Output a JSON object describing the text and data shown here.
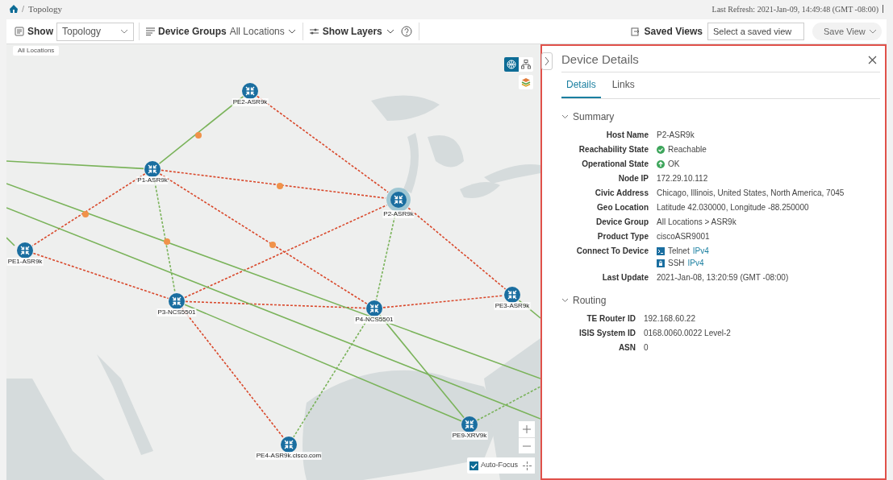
{
  "breadcrumb": {
    "separator": "/",
    "items": [
      "Topology"
    ],
    "last_refresh": "Last Refresh: 2021-Jan-09, 14:49:48 (GMT -08:00)"
  },
  "toolbar": {
    "show_label": "Show",
    "show_value": "Topology",
    "device_groups_label": "Device Groups",
    "device_groups_value": "All Locations",
    "show_layers": "Show Layers",
    "saved_views_label": "Saved Views",
    "saved_view_placeholder": "Select a saved view",
    "save_view": "Save View"
  },
  "map": {
    "badge": "All Locations",
    "nodes": [
      {
        "label": "PE2-ASR9k",
        "selected": false
      },
      {
        "label": "P1-ASR9k",
        "selected": false
      },
      {
        "label": "P2-ASR9k",
        "selected": true
      },
      {
        "label": "PE1-ASR9k",
        "selected": false
      },
      {
        "label": "P3-NCS5501",
        "selected": false
      },
      {
        "label": "P4-NCS5501",
        "selected": false
      },
      {
        "label": "PE3-ASR9k",
        "selected": false
      },
      {
        "label": "PE9-XRV9k",
        "selected": false
      },
      {
        "label": "PE4-ASR9k.cisco.com",
        "selected": false
      }
    ],
    "view_modes": [
      {
        "kind": "geo",
        "selected": true
      },
      {
        "kind": "logical",
        "selected": false
      }
    ],
    "auto_focus": {
      "label": "Auto-Focus",
      "checked": true
    }
  },
  "panel": {
    "title": "Device Details",
    "tabs": [
      {
        "label": "Details",
        "selected": true
      },
      {
        "label": "Links",
        "selected": false
      }
    ],
    "sections": [
      {
        "title": "Summary",
        "expanded": true,
        "rows": [
          {
            "label": "Host Name",
            "kind": "text",
            "value": "P2-ASR9k"
          },
          {
            "label": "Reachability State",
            "kind": "reachable",
            "value": "Reachable"
          },
          {
            "label": "Operational State",
            "kind": "up",
            "value": "OK"
          },
          {
            "label": "Node IP",
            "kind": "text",
            "value": "172.29.10.112"
          },
          {
            "label": "Civic Address",
            "kind": "text",
            "value": "Chicago, Illinois, United States, North America, 7045"
          },
          {
            "label": "Geo Location",
            "kind": "text",
            "value": "Latitude 42.030000, Longitude -88.250000"
          },
          {
            "label": "Device Group",
            "kind": "text",
            "value": "All Locations > ASR9k"
          },
          {
            "label": "Product Type",
            "kind": "text",
            "value": "ciscoASR9001"
          },
          {
            "label": "Connect To Device",
            "kind": "connect",
            "options": [
              {
                "kind": "telnet",
                "text": "Telnet",
                "link": "IPv4"
              },
              {
                "kind": "ssh",
                "text": "SSH",
                "link": "IPv4"
              }
            ]
          },
          {
            "label": "Last Update",
            "kind": "text",
            "value": "2021-Jan-08, 13:20:59 (GMT -08:00)"
          }
        ]
      },
      {
        "title": "Routing",
        "expanded": true,
        "rows": [
          {
            "label": "TE Router ID",
            "kind": "text",
            "value": "192.168.60.22"
          },
          {
            "label": "ISIS System ID",
            "kind": "text",
            "value": "0168.0060.0022 Level-2"
          },
          {
            "label": "ASN",
            "kind": "text",
            "value": "0"
          }
        ]
      }
    ]
  }
}
